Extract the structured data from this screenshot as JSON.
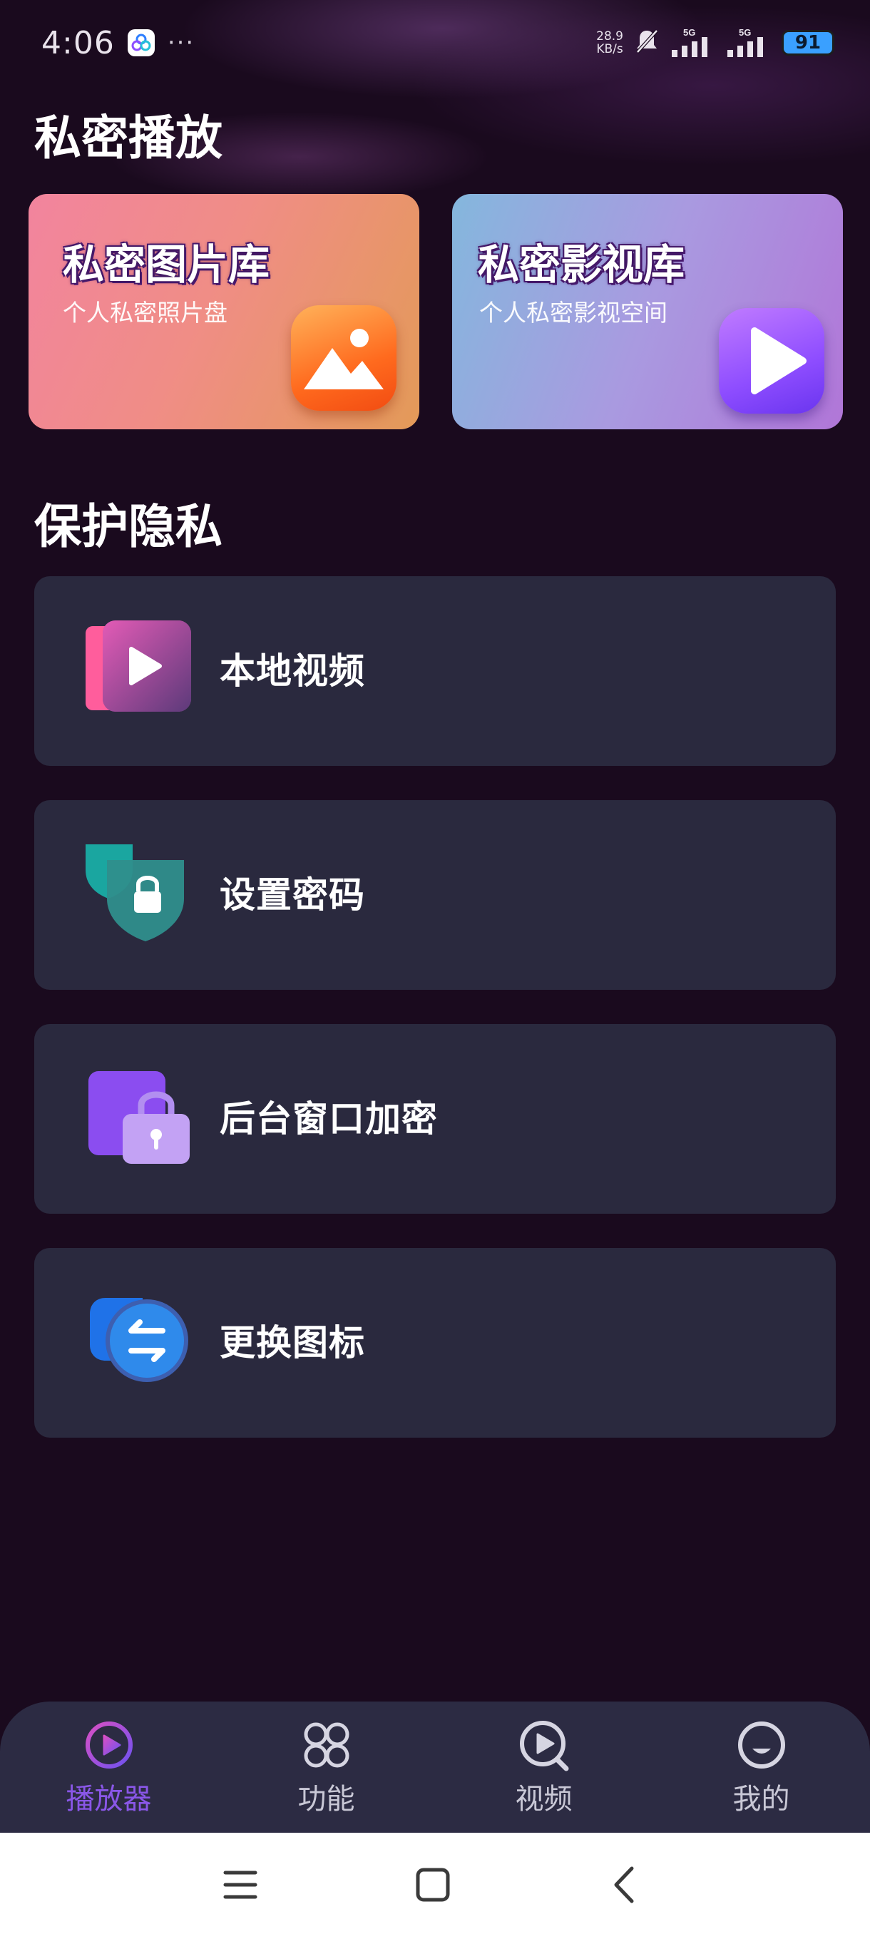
{
  "status_bar": {
    "time": "4:06",
    "dots": "···",
    "net_speed_value": "28.9",
    "net_speed_unit": "KB/s",
    "signal1_label": "5G",
    "signal2_label": "5G",
    "battery": "91"
  },
  "sections": {
    "private_play": "私密播放",
    "protect_privacy": "保护隐私"
  },
  "cards": {
    "photo": {
      "title": "私密图片库",
      "subtitle": "个人私密照片盘",
      "icon": "photo-gallery-icon"
    },
    "video": {
      "title": "私密影视库",
      "subtitle": "个人私密影视空间",
      "icon": "play-icon"
    }
  },
  "list": [
    {
      "label": "本地视频",
      "icon": "local-video-icon"
    },
    {
      "label": "设置密码",
      "icon": "shield-lock-icon"
    },
    {
      "label": "后台窗口加密",
      "icon": "window-lock-icon"
    },
    {
      "label": "更换图标",
      "icon": "swap-icon"
    }
  ],
  "bottom_nav": {
    "active_index": 0,
    "accent_color": "#8a57e8",
    "items": [
      {
        "label": "播放器",
        "icon": "player-icon"
      },
      {
        "label": "功能",
        "icon": "grid-icon"
      },
      {
        "label": "视频",
        "icon": "video-search-icon"
      },
      {
        "label": "我的",
        "icon": "profile-icon"
      }
    ]
  },
  "system_nav": [
    "menu-icon",
    "home-icon",
    "back-icon"
  ]
}
